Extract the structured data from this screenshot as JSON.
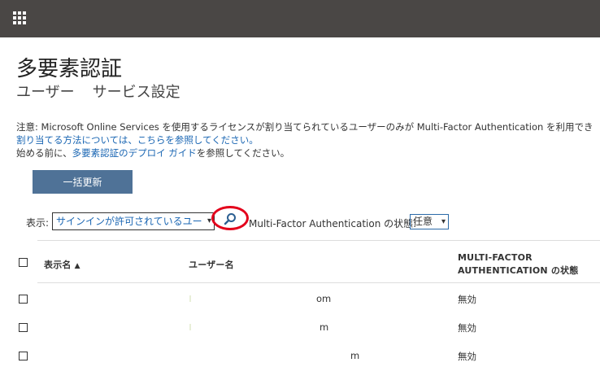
{
  "page": {
    "title": "多要素認証",
    "tabs": [
      "ユーザー",
      "サービス設定"
    ]
  },
  "notice": {
    "line1": "注意: Microsoft Online Services を使用するライセンスが割り当てられているユーザーのみが Multi-Factor Authentication を利用でき",
    "line2_link": "割り当てる方法については、こちらを参照してください。",
    "line3_pre": "始める前に、",
    "line3_link": "多要素認証のデプロイ ガイド",
    "line3_post": "を参照してください。"
  },
  "toolbar": {
    "bulk_update_label": "一括更新",
    "view_label": "表示:",
    "view_value": "サインインが許可されているユー",
    "mfa_status_label": "Multi-Factor Authentication の状態:",
    "mfa_status_value": "任意"
  },
  "table": {
    "headers": {
      "display_name": "表示名",
      "user_name": "ユーザー名",
      "mfa_line1": "MULTI-FACTOR",
      "mfa_line2": "AUTHENTICATION の状態"
    },
    "rows": [
      {
        "username_fragment": "om",
        "status": "無効"
      },
      {
        "username_fragment": "m",
        "status": "無効"
      },
      {
        "username_fragment": "m",
        "status": "無効"
      }
    ]
  },
  "icons": {
    "app_launcher": "waffle-icon",
    "search": "search-icon",
    "sort": "sort-ascending-icon"
  },
  "colors": {
    "topbar": "#4a4745",
    "primary_button": "#4f7297",
    "link": "#1a66b3",
    "highlight_ring": "#e3001b"
  }
}
